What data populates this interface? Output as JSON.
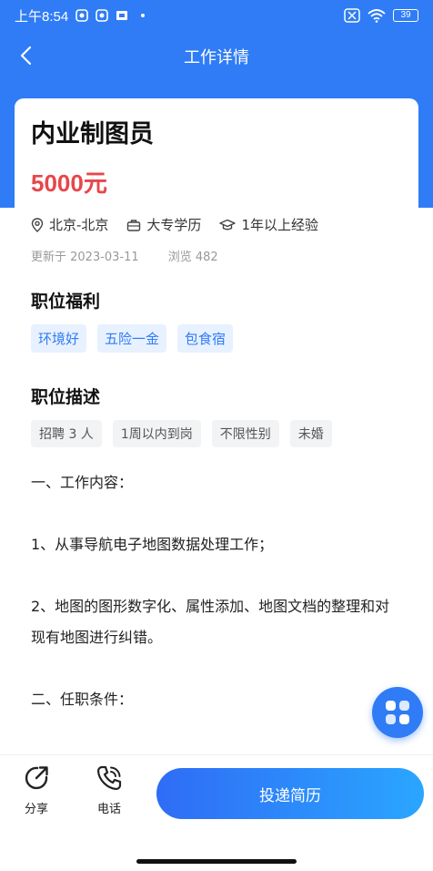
{
  "status_bar": {
    "time": "上午8:54",
    "battery": "39"
  },
  "nav": {
    "title": "工作详情"
  },
  "job": {
    "title": "内业制图员",
    "salary": "5000元",
    "location": "北京-北京",
    "education": "大专学历",
    "experience": "1年以上经验",
    "updated": "更新于 2023-03-11",
    "views": "浏览 482"
  },
  "benefits": {
    "title": "职位福利",
    "tags": [
      "环境好",
      "五险一金",
      "包食宿"
    ]
  },
  "description": {
    "title": "职位描述",
    "tags": [
      "招聘 3 人",
      "1周以内到岗",
      "不限性别",
      "未婚"
    ],
    "lines": [
      "一、工作内容：",
      "1、从事导航电子地图数据处理工作；",
      "2、地图的图形数字化、属性添加、地图文档的整理和对现有地图进行纠错。",
      "二、任职条件："
    ]
  },
  "bottom_bar": {
    "share_label": "分享",
    "phone_label": "电话",
    "apply_label": "投递简历"
  },
  "colors": {
    "primary": "#2f7cf6",
    "salary": "#e8464a"
  }
}
